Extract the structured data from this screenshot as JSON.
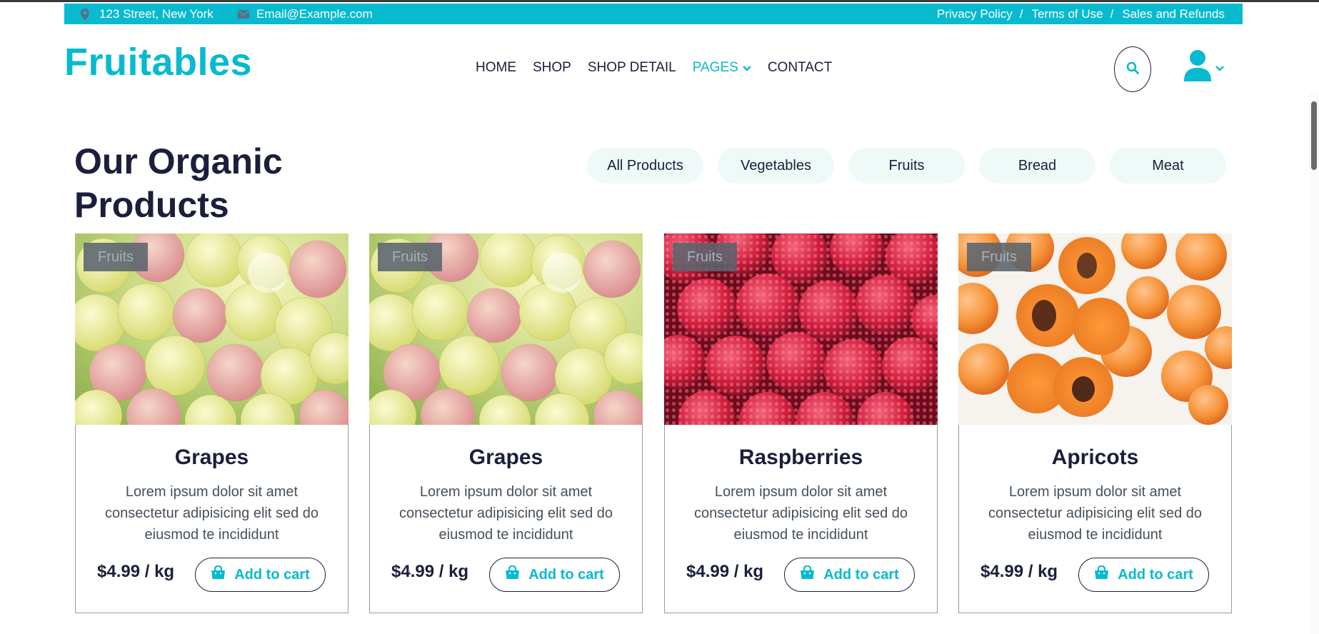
{
  "topbar": {
    "address": "123 Street, New York",
    "email": "Email@Example.com",
    "links": [
      "Privacy Policy",
      "Terms of Use",
      "Sales and Refunds"
    ],
    "separator": "/"
  },
  "header": {
    "logo": "Fruitables",
    "nav": [
      "HOME",
      "SHOP",
      "SHOP DETAIL",
      "PAGES",
      "CONTACT"
    ],
    "active_nav": "PAGES",
    "icons": [
      "search-icon",
      "user-icon",
      "chevron-down-icon"
    ]
  },
  "section": {
    "title": "Our Organic Products",
    "filters": [
      "All Products",
      "Vegetables",
      "Fruits",
      "Bread",
      "Meat"
    ]
  },
  "products": [
    {
      "badge": "Fruits",
      "name": "Grapes",
      "desc": "Lorem ipsum dolor sit amet consectetur adipisicing elit sed do eiusmod te incididunt",
      "price": "$4.99 / kg",
      "button": "Add to cart"
    },
    {
      "badge": "Fruits",
      "name": "Grapes",
      "desc": "Lorem ipsum dolor sit amet consectetur adipisicing elit sed do eiusmod te incididunt",
      "price": "$4.99 / kg",
      "button": "Add to cart"
    },
    {
      "badge": "Fruits",
      "name": "Raspberries",
      "desc": "Lorem ipsum dolor sit amet consectetur adipisicing elit sed do eiusmod te incididunt",
      "price": "$4.99 / kg",
      "button": "Add to cart"
    },
    {
      "badge": "Fruits",
      "name": "Apricots",
      "desc": "Lorem ipsum dolor sit amet consectetur adipisicing elit sed do eiusmod te incididunt",
      "price": "$4.99 / kg",
      "button": "Add to cart"
    }
  ],
  "colors": {
    "accent": "#08bad0",
    "text": "#1b1f3b",
    "filter_bg": "#eef9f8"
  }
}
